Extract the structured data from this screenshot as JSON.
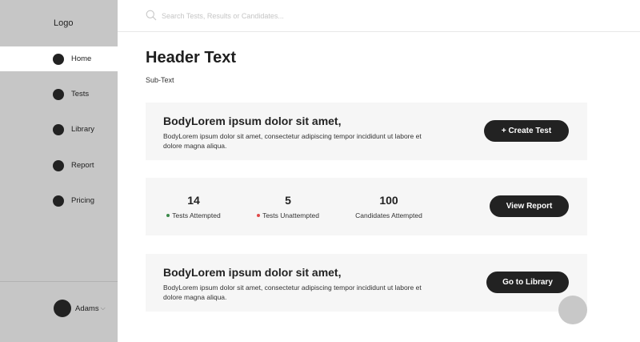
{
  "sidebar": {
    "logo": "Logo",
    "items": [
      {
        "label": "Home",
        "active": true
      },
      {
        "label": "Tests",
        "active": false
      },
      {
        "label": "Library",
        "active": false
      },
      {
        "label": "Report",
        "active": false
      },
      {
        "label": "Pricing",
        "active": false
      }
    ],
    "user": {
      "name": "Adams",
      "chevron": "⌵"
    }
  },
  "search": {
    "placeholder": "Search Tests, Results or Candidates..."
  },
  "header": {
    "title": "Header Text",
    "subtitle": "Sub-Text"
  },
  "cards": {
    "create": {
      "title": "BodyLorem ipsum dolor sit amet,",
      "body": "BodyLorem ipsum dolor sit amet, consectetur adipiscing tempor incididunt ut labore et dolore magna aliqua.",
      "button": "+ Create Test"
    },
    "stats": {
      "items": [
        {
          "value": "14",
          "label": "Tests Attempted",
          "dot_color": "#3a8a4a"
        },
        {
          "value": "5",
          "label": "Tests Unattempted",
          "dot_color": "#e04848"
        },
        {
          "value": "100",
          "label": "Candidates Attempted"
        }
      ],
      "button": "View Report"
    },
    "library": {
      "title": "BodyLorem ipsum dolor sit amet,",
      "body": "BodyLorem ipsum dolor sit amet, consectetur adipiscing tempor incididunt ut labore et dolore magna aliqua.",
      "button": "Go to Library"
    }
  },
  "colors": {
    "sidebar": "#c6c6c6",
    "button": "#222222",
    "card": "#f6f6f6",
    "fab": "#c8c8c8"
  },
  "icons": {
    "search": "search-icon",
    "fab": "floating-action-button"
  }
}
